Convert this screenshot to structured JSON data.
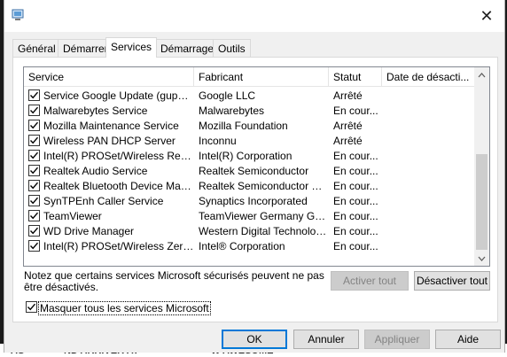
{
  "dialog": {
    "close_glyph": "✕"
  },
  "tabs": [
    {
      "label": "Général"
    },
    {
      "label": "Démarrer"
    },
    {
      "label": "Services"
    },
    {
      "label": "Démarrage"
    },
    {
      "label": "Outils"
    }
  ],
  "active_tab": "Services",
  "columns": {
    "service": "Service",
    "fabricant": "Fabricant",
    "statut": "Statut",
    "date": "Date de désacti..."
  },
  "services": [
    {
      "name": "Service Google Update (gupdatem)",
      "maker": "Google LLC",
      "status": "Arrêté",
      "checked": true
    },
    {
      "name": "Malwarebytes Service",
      "maker": "Malwarebytes",
      "status": "En cour...",
      "checked": true
    },
    {
      "name": "Mozilla Maintenance Service",
      "maker": "Mozilla Foundation",
      "status": "Arrêté",
      "checked": true
    },
    {
      "name": "Wireless PAN DHCP Server",
      "maker": "Inconnu",
      "status": "Arrêté",
      "checked": true
    },
    {
      "name": "Intel(R) PROSet/Wireless Regist...",
      "maker": "Intel(R) Corporation",
      "status": "En cour...",
      "checked": true
    },
    {
      "name": "Realtek Audio Service",
      "maker": "Realtek Semiconductor",
      "status": "En cour...",
      "checked": true
    },
    {
      "name": "Realtek Bluetooth Device Manag...",
      "maker": "Realtek Semiconductor Corp.",
      "status": "En cour...",
      "checked": true
    },
    {
      "name": "SynTPEnh Caller Service",
      "maker": "Synaptics Incorporated",
      "status": "En cour...",
      "checked": true
    },
    {
      "name": "TeamViewer",
      "maker": "TeamViewer Germany GmbH",
      "status": "En cour...",
      "checked": true
    },
    {
      "name": "WD Drive Manager",
      "maker": "Western Digital Technologi...",
      "status": "En cour...",
      "checked": true
    },
    {
      "name": "Intel(R) PROSet/Wireless Zero C...",
      "maker": "Intel® Corporation",
      "status": "En cour...",
      "checked": true
    }
  ],
  "note": "Notez que certains services Microsoft sécurisés peuvent ne pas être désactivés.",
  "buttons": {
    "enable_all": "Activer tout",
    "disable_all": "Désactiver tout",
    "ok": "OK",
    "cancel": "Annuler",
    "apply": "Appliquer",
    "help": "Aide"
  },
  "hide_ms": {
    "label": "Masquer tous les services Microsoft",
    "checked": true
  },
  "background": {
    "text_a": "AS",
    "text_b": "ND ARRIVER AT",
    "text_c": "W AWESOME"
  },
  "colors": {
    "accent": "#0078d7",
    "dialog_bg": "#f0f0f0",
    "panel_bg": "#ffffff"
  }
}
